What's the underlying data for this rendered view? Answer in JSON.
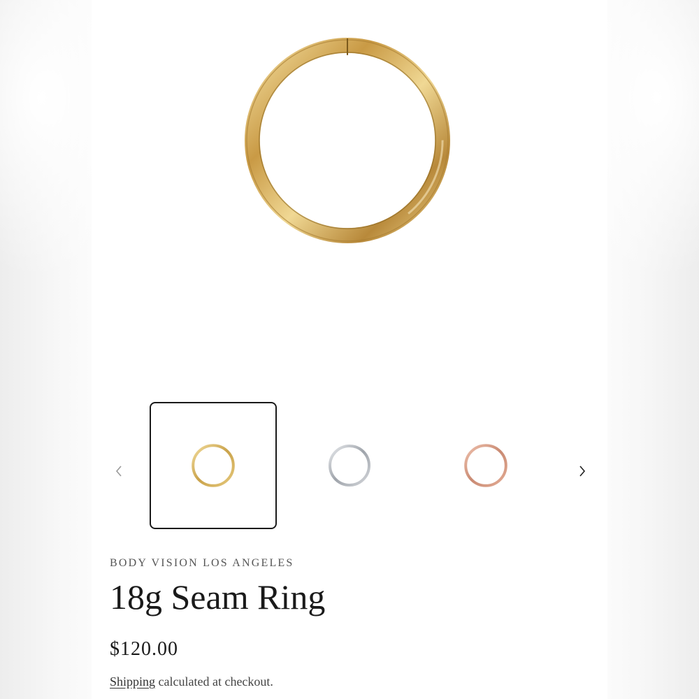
{
  "product": {
    "vendor": "BODY VISION LOS ANGELES",
    "title": "18g Seam Ring",
    "price": "$120.00",
    "shipping_link": "Shipping",
    "shipping_suffix": " calculated at checkout."
  },
  "gallery": {
    "main_image": {
      "icon": "gold-ring-icon",
      "color": "#c9a24a"
    },
    "prev_icon": "chevron-left-icon",
    "next_icon": "chevron-right-icon",
    "selected_index": 0,
    "thumbnails": [
      {
        "icon": "gold-ring-icon",
        "color": "#c9a24a"
      },
      {
        "icon": "silver-ring-icon",
        "color": "#a9adb3"
      },
      {
        "icon": "rose-gold-ring-icon",
        "color": "#c98a72"
      }
    ]
  }
}
